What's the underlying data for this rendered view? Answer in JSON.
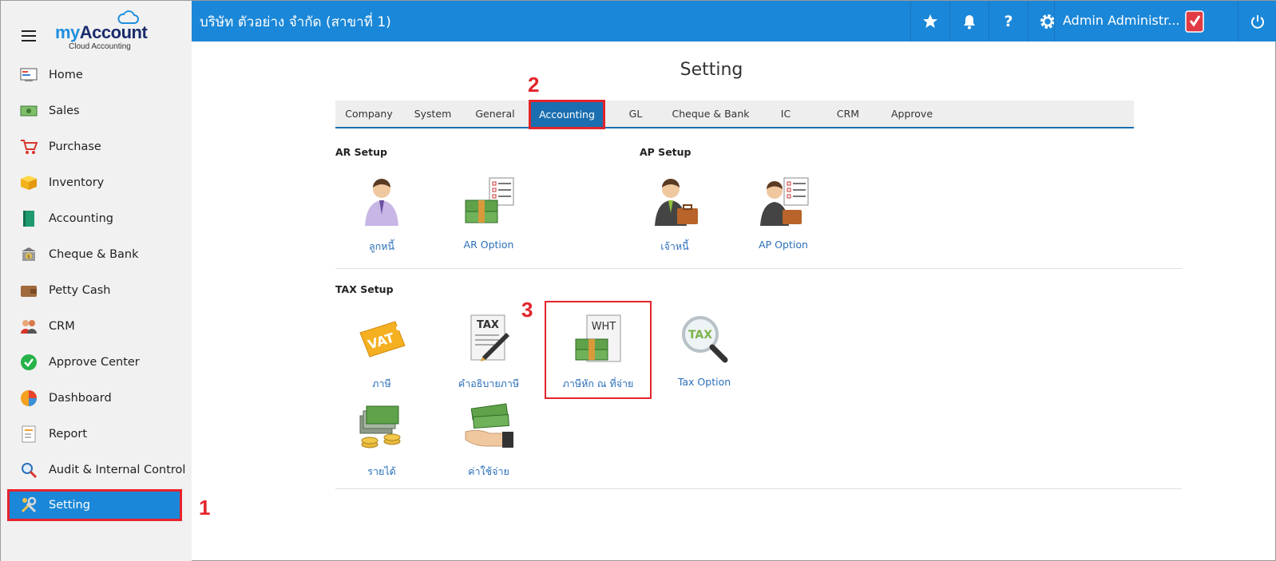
{
  "app": {
    "logo_my": "my",
    "logo_account": "Account",
    "logo_sub": "Cloud Accounting"
  },
  "sidebar": {
    "items": [
      {
        "label": "Home",
        "icon": "home-icon"
      },
      {
        "label": "Sales",
        "icon": "sales-icon"
      },
      {
        "label": "Purchase",
        "icon": "cart-icon"
      },
      {
        "label": "Inventory",
        "icon": "box-icon"
      },
      {
        "label": "Accounting",
        "icon": "book-icon"
      },
      {
        "label": "Cheque & Bank",
        "icon": "bank-icon"
      },
      {
        "label": "Petty Cash",
        "icon": "wallet-icon"
      },
      {
        "label": "CRM",
        "icon": "people-icon"
      },
      {
        "label": "Approve Center",
        "icon": "check-icon"
      },
      {
        "label": "Dashboard",
        "icon": "pie-chart-icon"
      },
      {
        "label": "Report",
        "icon": "report-icon"
      },
      {
        "label": "Audit & Internal Control",
        "icon": "magnifier-icon"
      },
      {
        "label": "Setting",
        "icon": "tools-icon",
        "active": true
      }
    ]
  },
  "topbar": {
    "company": "บริษัท ตัวอย่าง จำกัด (สาขาที่ 1)",
    "user_name": "Admin Administr..."
  },
  "main": {
    "title": "Setting",
    "tabs": [
      "Company",
      "System",
      "General",
      "Accounting",
      "GL",
      "Cheque & Bank",
      "IC",
      "CRM",
      "Approve"
    ],
    "active_tab": "Accounting",
    "ar_setup": {
      "title": "AR Setup",
      "items": [
        "ลูกหนี้",
        "AR Option"
      ]
    },
    "ap_setup": {
      "title": "AP Setup",
      "items": [
        "เจ้าหนี้",
        "AP Option"
      ]
    },
    "tax_setup": {
      "title": "TAX Setup",
      "items": [
        "ภาษี",
        "คำอธิบายภาษี",
        "ภาษีหัก ณ ที่จ่าย",
        "Tax Option",
        "รายได้",
        "ค่าใช้จ่าย"
      ]
    }
  },
  "annotations": {
    "step1": "1",
    "step2": "2",
    "step3": "3"
  },
  "icons": {
    "vat_text": "VAT",
    "tax_text": "TAX",
    "wht_text": "WHT",
    "tax_option_text": "TAX"
  },
  "colors": {
    "primary": "#1b87d8",
    "highlight": "#e3242b",
    "link": "#2a6fb8"
  }
}
